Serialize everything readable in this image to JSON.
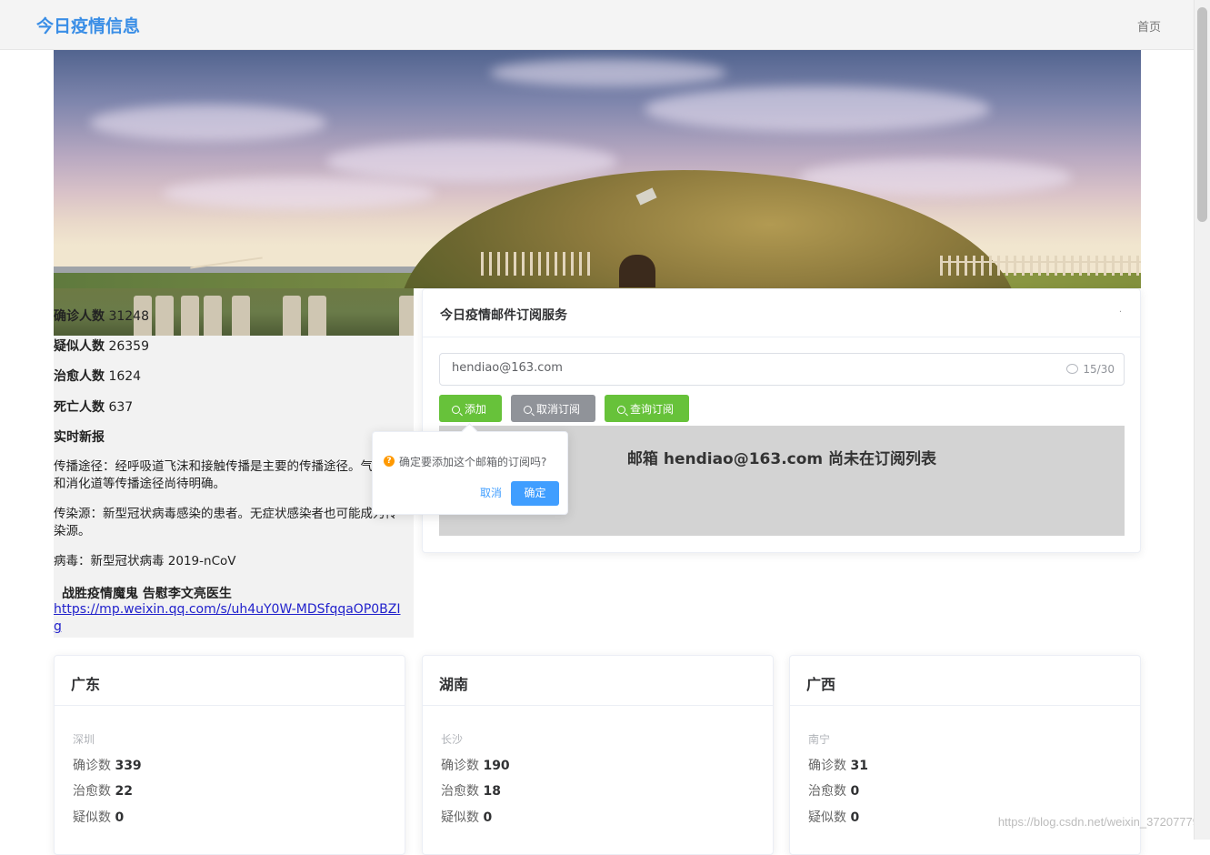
{
  "header": {
    "brand": "今日疫情信息",
    "nav_home": "首页"
  },
  "stats": {
    "confirmed_label": "确诊人数",
    "confirmed_value": "31248",
    "suspected_label": "疑似人数",
    "suspected_value": "26359",
    "cured_label": "治愈人数",
    "cured_value": "1624",
    "dead_label": "死亡人数",
    "dead_value": "637"
  },
  "news": {
    "title": "实时新报",
    "transmission": "传播途径：经呼吸道飞沫和接触传播是主要的传播途径。气溶胶和消化道等传播途径尚待明确。",
    "source": "传染源：新型冠状病毒感染的患者。无症状感染者也可能成为传染源。",
    "virus": "病毒：新型冠状病毒 2019-nCoV",
    "headline": "战胜疫情魔鬼 告慰李文亮医生",
    "link": "https://mp.weixin.qq.com/s/uh4uY0W-MDSfqqaOP0BZIg"
  },
  "subscription": {
    "title": "今日疫情邮件订阅服务",
    "dot": "·",
    "email_value": "hendiao@163.com",
    "char_count": "15/30",
    "add_label": "添加",
    "cancel_label": "取消订阅",
    "query_label": "查询订阅",
    "result": "邮箱 hendiao@163.com 尚未在订阅列表"
  },
  "popconfirm": {
    "icon": "?",
    "message": "确定要添加这个邮箱的订阅吗?",
    "cancel": "取消",
    "confirm": "确定"
  },
  "provinces": [
    {
      "name": "广东",
      "city": "深圳",
      "confirmed_label": "确诊数",
      "confirmed": "339",
      "cured_label": "治愈数",
      "cured": "22",
      "suspected_label": "疑似数",
      "suspected": "0"
    },
    {
      "name": "湖南",
      "city": "长沙",
      "confirmed_label": "确诊数",
      "confirmed": "190",
      "cured_label": "治愈数",
      "cured": "18",
      "suspected_label": "疑似数",
      "suspected": "0"
    },
    {
      "name": "广西",
      "city": "南宁",
      "confirmed_label": "确诊数",
      "confirmed": "31",
      "cured_label": "治愈数",
      "cured": "0",
      "suspected_label": "疑似数",
      "suspected": "0"
    }
  ],
  "watermark": "https://blog.csdn.net/weixin_37207779",
  "colors": {
    "brand": "#3a8ee6",
    "success": "#67c23a",
    "info": "#909399",
    "primary": "#409eff",
    "warning": "#ff9900"
  }
}
